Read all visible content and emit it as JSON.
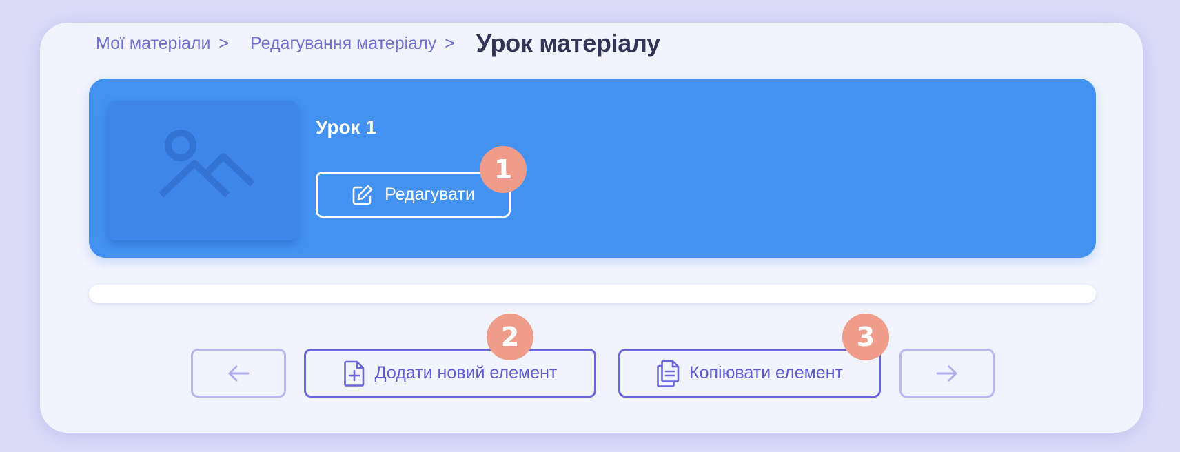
{
  "breadcrumb": {
    "items": [
      {
        "label": "Мої матеріали",
        "separator": ">"
      },
      {
        "label": "Редагування матеріалу",
        "separator": ">"
      }
    ],
    "current": "Урок матеріалу"
  },
  "lesson": {
    "title": "Урок 1",
    "edit_label": "Редагувати",
    "thumbnail_icon": "image-placeholder-icon"
  },
  "badges": [
    "1",
    "2",
    "3"
  ],
  "actions": {
    "prev_icon": "arrow-left-icon",
    "add_label": "Додати новий елемент",
    "add_icon": "file-plus-icon",
    "copy_label": "Копіювати елемент",
    "copy_icon": "copy-file-icon",
    "next_icon": "arrow-right-icon"
  },
  "colors": {
    "page_bg": "#dcdcf8",
    "card_bg": "#f1f3fd",
    "banner": "#4391f1",
    "accent": "#6b67d6",
    "badge": "#ef9c8a",
    "breadcrumb_link": "#6f6fd0",
    "title_text": "#343556"
  }
}
